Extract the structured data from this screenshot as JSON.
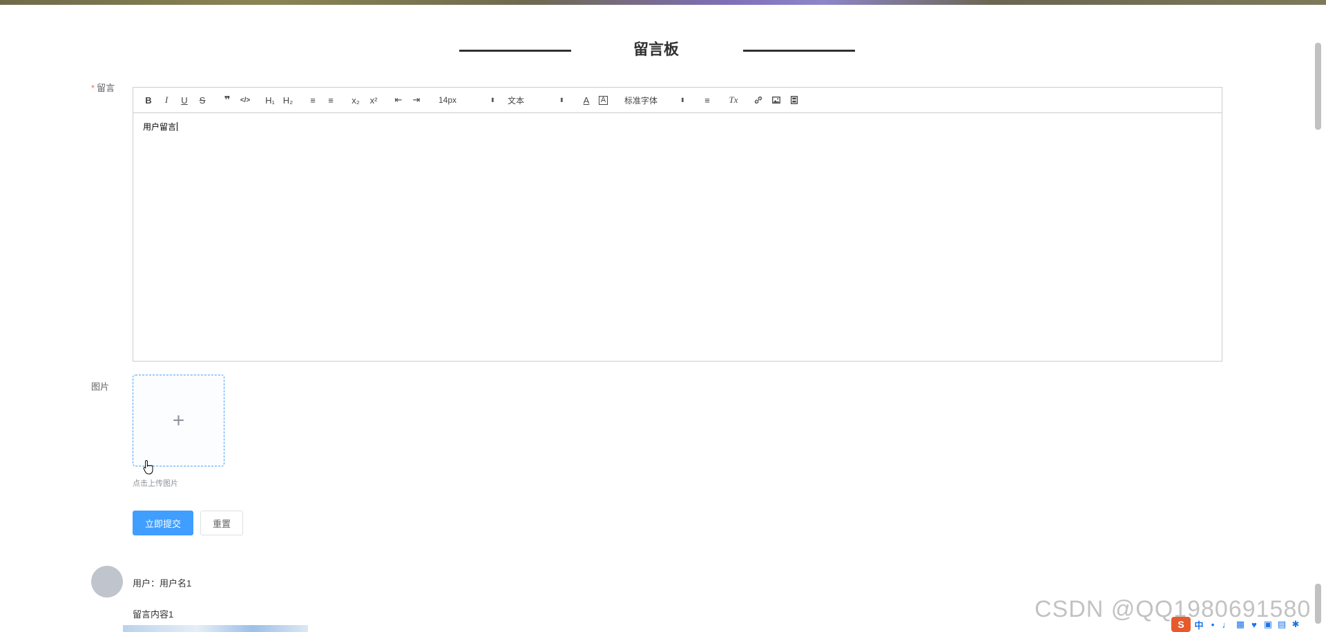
{
  "page": {
    "title": "留言板"
  },
  "form": {
    "message_label": "留言",
    "required_mark": "*",
    "image_label": "图片",
    "upload_tip": "点击上传图片",
    "upload_plus": "+",
    "submit_label": "立即提交",
    "reset_label": "重置"
  },
  "editor": {
    "content": "用户留言",
    "toolbar": {
      "bold": "B",
      "italic": "I",
      "underline": "U",
      "strike": "S",
      "blockquote": "❞",
      "code": "</>",
      "h1": "H₁",
      "h2": "H₂",
      "ordered_list": "≡",
      "bullet_list": "≡",
      "sub": "x₂",
      "sup": "x²",
      "outdent": "⇤",
      "indent": "⇥",
      "size_value": "14px",
      "header_value": "文本",
      "font_color": "A",
      "bg_color": "A",
      "font_value": "标准字体",
      "align": "≡",
      "clean": "Tx",
      "picker_arrow": "⬍"
    }
  },
  "messages": [
    {
      "user_label": "用户：用户名1",
      "content": "留言内容1"
    }
  ],
  "watermark": "CSDN @QQ1980691580",
  "ime": {
    "logo": "S",
    "lang": "中"
  },
  "colors": {
    "primary": "#409eff",
    "required": "#f56c6c"
  }
}
